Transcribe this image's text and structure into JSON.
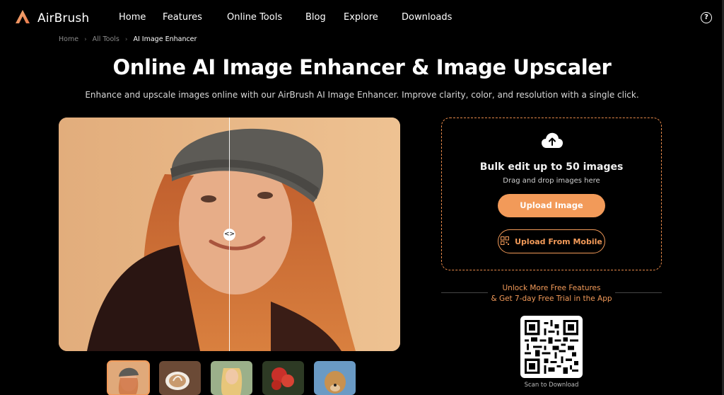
{
  "nav": {
    "brand": "AirBrush",
    "items": [
      {
        "label": "Home"
      },
      {
        "label": "Features"
      },
      {
        "label": "Online Tools"
      },
      {
        "label": "Blog"
      },
      {
        "label": "Explore"
      },
      {
        "label": "Downloads"
      }
    ],
    "help_symbol": "?"
  },
  "breadcrumb": {
    "items": [
      "Home",
      "All Tools",
      "AI Image Enhancer"
    ]
  },
  "hero": {
    "title": "Online AI Image Enhancer & Image Upscaler",
    "subtitle": "Enhance and upscale images online with our AirBrush AI Image Enhancer. Improve clarity, color, and resolution with a single click."
  },
  "compare": {
    "handle_symbol": "<>"
  },
  "thumbnails": [
    {
      "name": "woman-beanie",
      "active": true
    },
    {
      "name": "latte-art",
      "active": false
    },
    {
      "name": "blonde-woman",
      "active": false
    },
    {
      "name": "red-flowers",
      "active": false
    },
    {
      "name": "dog",
      "active": false
    }
  ],
  "upload": {
    "heading": "Bulk edit up to 50 images",
    "hint": "Drag and drop images here",
    "upload_button": "Upload Image",
    "mobile_button": "Upload From Mobile"
  },
  "promo": {
    "line1": "Unlock More Free Features",
    "line2": "& Get 7-day Free Trial in the App",
    "qr_caption": "Scan to Download"
  },
  "colors": {
    "accent": "#f29a59",
    "background": "#000000"
  }
}
